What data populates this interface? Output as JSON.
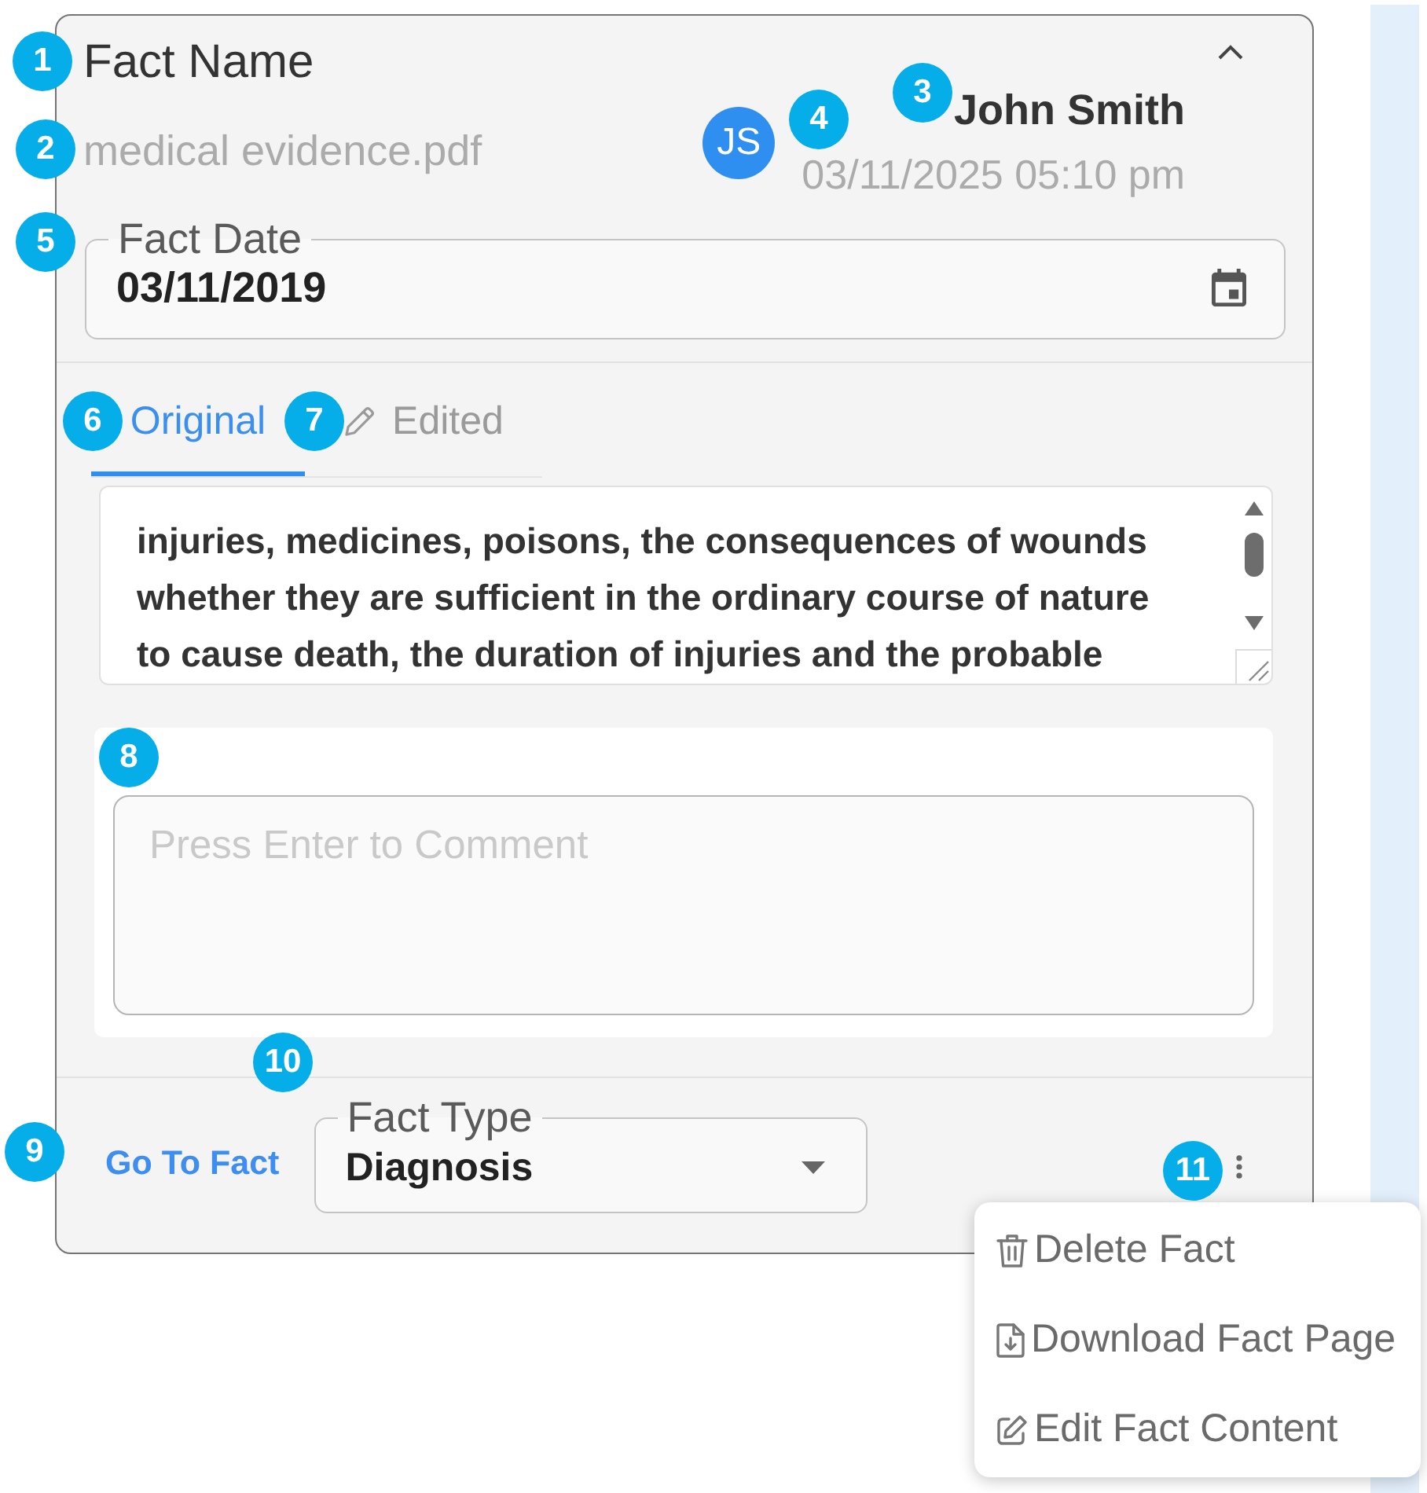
{
  "callouts": [
    {
      "label": "1"
    },
    {
      "label": "2"
    },
    {
      "label": "3"
    },
    {
      "label": "4"
    },
    {
      "label": "5"
    },
    {
      "label": "6"
    },
    {
      "label": "7"
    },
    {
      "label": "8"
    },
    {
      "label": "9"
    },
    {
      "label": "10"
    },
    {
      "label": "11"
    }
  ],
  "fact_card": {
    "title": "Fact Name",
    "expanded": true,
    "file_name": "medical evidence.pdf",
    "author": {
      "initials": "JS",
      "name": "John Smith",
      "timestamp": "03/11/2025 05:10 pm"
    },
    "fact_date": {
      "label": "Fact Date",
      "value": "03/11/2019"
    },
    "tabs": [
      {
        "label": "Original",
        "kind": "plain",
        "selected": true
      },
      {
        "label": "Edited",
        "kind": "edit",
        "selected": false
      }
    ],
    "content": {
      "text": "injuries, medicines, poisons, the consequences of wounds whether they are sufficient in the ordinary course of nature to cause death, the duration of injuries and the probable"
    },
    "comment": {
      "placeholder": "Press Enter to Comment"
    },
    "footer": {
      "link": "Go To Fact",
      "fact_type": {
        "label": "Fact Type",
        "value": "Diagnosis"
      },
      "menu": {
        "open": true,
        "items": [
          {
            "kind": "delete",
            "label": "Delete Fact"
          },
          {
            "kind": "download",
            "label": "Download Fact Page"
          },
          {
            "kind": "edit",
            "label": "Edit Fact Content"
          }
        ]
      }
    }
  }
}
